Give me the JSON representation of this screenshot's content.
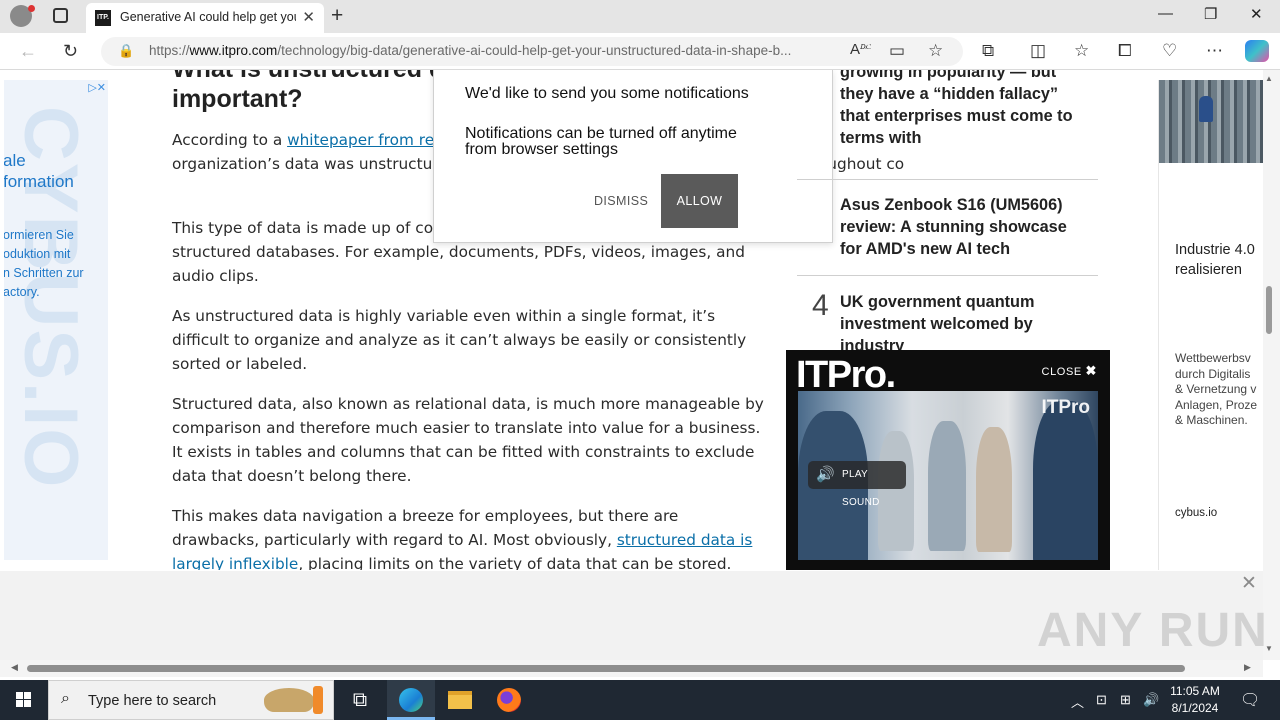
{
  "browser": {
    "tab_title": "Generative AI could help get your unstructured data in shape",
    "tab_favicon": "ITP.",
    "url_prefix": "https://",
    "url_domain": "www.itpro.com",
    "url_path": "/technology/big-data/generative-ai-could-help-get-your-unstructured-data-in-shape-b..."
  },
  "article": {
    "heading": "What is unstructured data and why is it important?",
    "p1_pre": "According to a ",
    "p1_link": "whitepaper from re",
    "p1_post": "organization’s data was unstructur                                         and various formats throughout co",
    "p2": "This type of data is made up of con                                       loaded into structured databases. For example, documents, PDFs, videos, images, and audio clips.",
    "p3": "As unstructured data is highly variable even within a single format, it’s difficult to organize and analyze as it can’t always be easily or consistently sorted or labeled.",
    "p4": "Structured data, also known as relational data, is much more manageable by comparison and therefore much easier to translate into value for a business. It exists in tables and columns that can be fitted with constraints to exclude data that doesn’t belong there.",
    "p5_pre": "This makes data navigation a breeze for employees, but there are drawbacks, particularly with regard to AI. Most obviously, ",
    "p5_link": "structured data is largely inflexible",
    "p5_post": ", placing limits on the variety of data that can be stored."
  },
  "notification": {
    "message1": "We'd like to send you some notifications",
    "message2": "Notifications can be turned off anytime from browser settings",
    "dismiss": "DISMISS",
    "allow": "ALLOW"
  },
  "sidebar": {
    "story_partial": "growing in popularity — but they have a “hidden fallacy” that enterprises must come to terms with",
    "story3": "Asus Zenbook S16 (UM5606) review: A stunning showcase for AMD's new AI tech",
    "rank4": "4",
    "story4": "UK government quantum investment welcomed by industry"
  },
  "video": {
    "logo": "ITPro.",
    "close": "CLOSE",
    "watermark": "ITPro",
    "play_sound": "PLAY SOUND"
  },
  "left_ad": {
    "heading": "ale\nformation",
    "text": "ormieren Sie\noduktion mit\nn Schritten zur\nactory."
  },
  "right_ad": {
    "line1": "Industrie 4.0\nrealisieren",
    "line2": "Wettbewerbsv\ndurch Digitalis\n& Vernetzung v\nAnlagen, Proze\n& Maschinen.",
    "line3": "cybus.io"
  },
  "overlay": {
    "watermark": "ANY RUN"
  },
  "taskbar": {
    "search_placeholder": "Type here to search",
    "time": "11:05 AM",
    "date": "8/1/2024"
  },
  "colors": {
    "link": "#0a6fa8",
    "allow_button": "#5a5a5a",
    "taskbar": "#1f2833"
  }
}
